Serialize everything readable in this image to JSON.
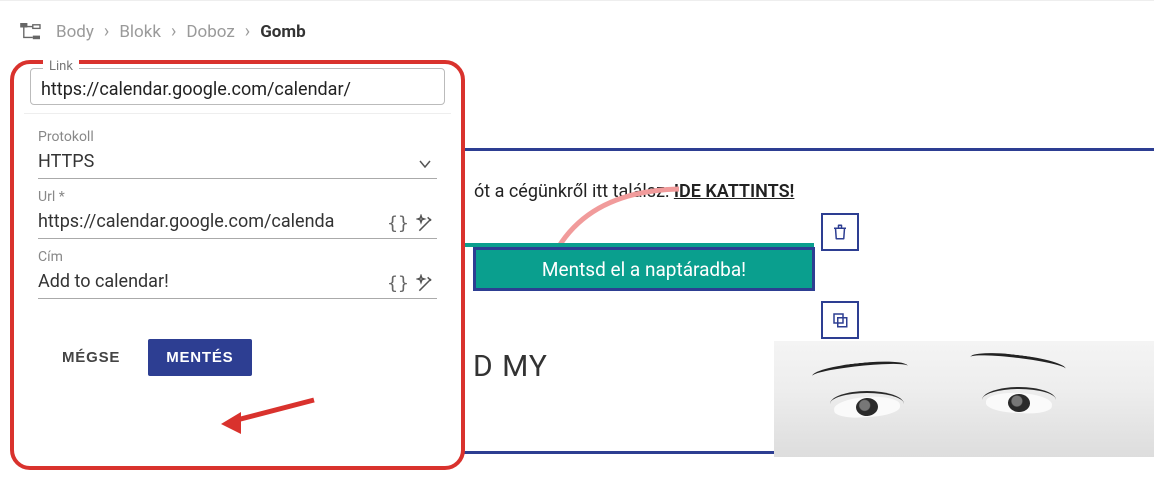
{
  "breadcrumb": {
    "items": [
      "Body",
      "Blokk",
      "Doboz"
    ],
    "current": "Gomb"
  },
  "panel": {
    "link": {
      "label": "Link",
      "value": "https://calendar.google.com/calendar/"
    },
    "protocol": {
      "label": "Protokoll",
      "value": "HTTPS"
    },
    "url": {
      "label": "Url *",
      "value": "https://calendar.google.com/calenda"
    },
    "title": {
      "label": "Cím",
      "value": "Add to calendar!"
    },
    "cancel": "MÉGSE",
    "save": "MENTÉS"
  },
  "canvas": {
    "hint_prefix": "ót a cégünkről itt találsz: ",
    "hint_link": "IDE KATTINTS!",
    "cta": "Mentsd el a naptáradba!",
    "heading": "D MY"
  },
  "icons": {
    "brackets": "{}"
  }
}
